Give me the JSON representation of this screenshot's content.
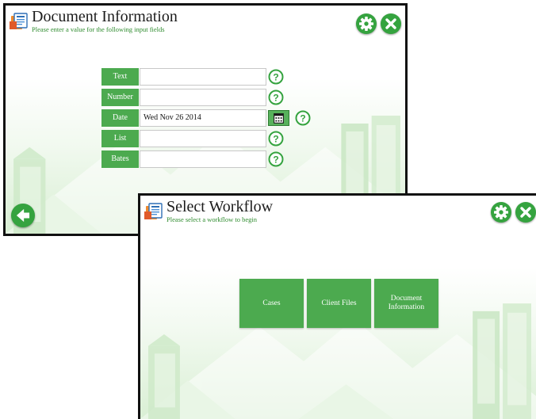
{
  "document_information": {
    "title": "Document Information",
    "subtitle": "Please enter a value for the following input fields",
    "fields": [
      {
        "label": "Text",
        "value": ""
      },
      {
        "label": "Number",
        "value": ""
      },
      {
        "label": "Date",
        "value": "Wed Nov 26 2014"
      },
      {
        "label": "List",
        "value": ""
      },
      {
        "label": "Bates",
        "value": ""
      }
    ]
  },
  "select_workflow": {
    "title": "Select Workflow",
    "subtitle": "Please select a workflow to begin",
    "workflows": [
      {
        "label": "Cases"
      },
      {
        "label": "Client Files"
      },
      {
        "label": "Document Information"
      }
    ]
  },
  "icons": {
    "app": "document-stack-icon",
    "settings": "gear-icon",
    "close": "close-icon",
    "back": "arrow-left-icon",
    "help": "question-icon",
    "calendar": "calendar-icon"
  },
  "colors": {
    "accent_green": "#4caa4f",
    "button_green": "#35a33f",
    "subtitle_green": "#2e8b2e"
  }
}
